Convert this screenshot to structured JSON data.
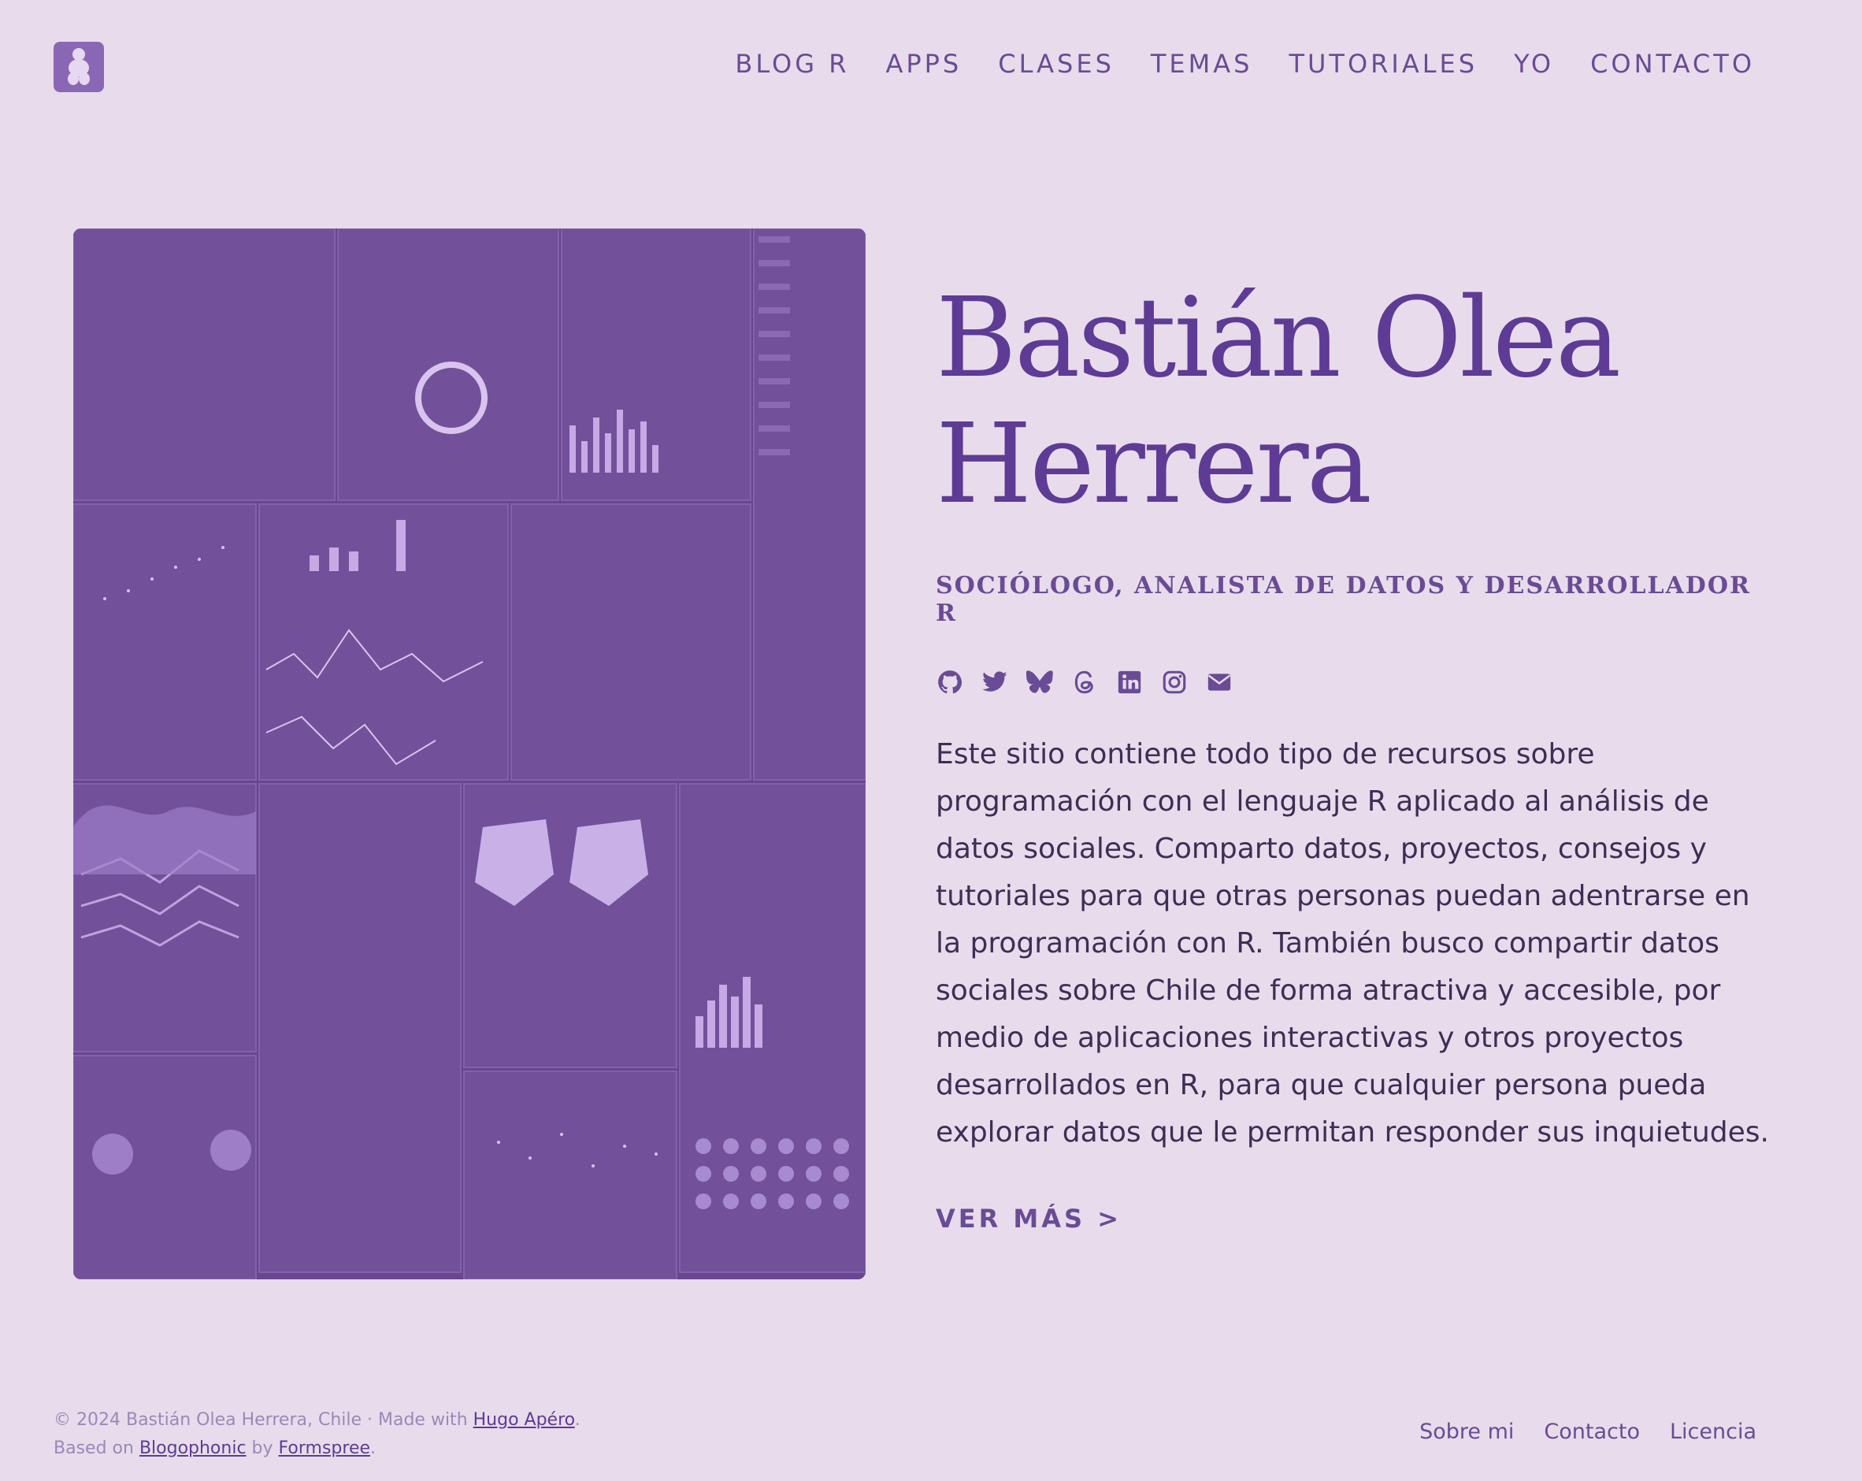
{
  "header": {
    "nav": [
      "BLOG R",
      "APPS",
      "CLASES",
      "TEMAS",
      "TUTORIALES",
      "YO",
      "CONTACTO"
    ]
  },
  "hero": {
    "title_line1": "Bastián Olea",
    "title_line2": "Herrera",
    "subtitle": "SOCIÓLOGO, ANALISTA DE DATOS Y DESARROLLADOR R",
    "social_icons": [
      "github-icon",
      "twitter-icon",
      "bluesky-icon",
      "threads-icon",
      "linkedin-icon",
      "instagram-icon",
      "email-icon"
    ],
    "bio": "Este sitio contiene todo tipo de recursos sobre programación con el lenguaje R aplicado al análisis de datos sociales. Comparto datos, proyectos, consejos y tutoriales para que otras personas puedan adentrarse en la programación con R. También busco compartir datos sociales sobre Chile de forma atractiva y accesible, por medio de aplicaciones interactivas y otros proyectos desarrollados en R, para que cualquier persona pueda explorar datos que le permitan responder sus inquietudes.",
    "more_label": "VER MÁS >"
  },
  "footer": {
    "copyright": "© 2024 Bastián Olea Herrera, Chile",
    "sep": " · ",
    "made_with": "Made with ",
    "hugo_link": "Hugo Apéro",
    "based_on": "Based on ",
    "blogophonic_link": "Blogophonic",
    "by": " by ",
    "formspree_link": "Formspree",
    "links": [
      "Sobre mi",
      "Contacto",
      "Licencia"
    ]
  },
  "colors": {
    "background": "#e8dcec",
    "accent": "#5e3b94",
    "nav": "#6a4b95",
    "image_tint": "#6a4591"
  }
}
